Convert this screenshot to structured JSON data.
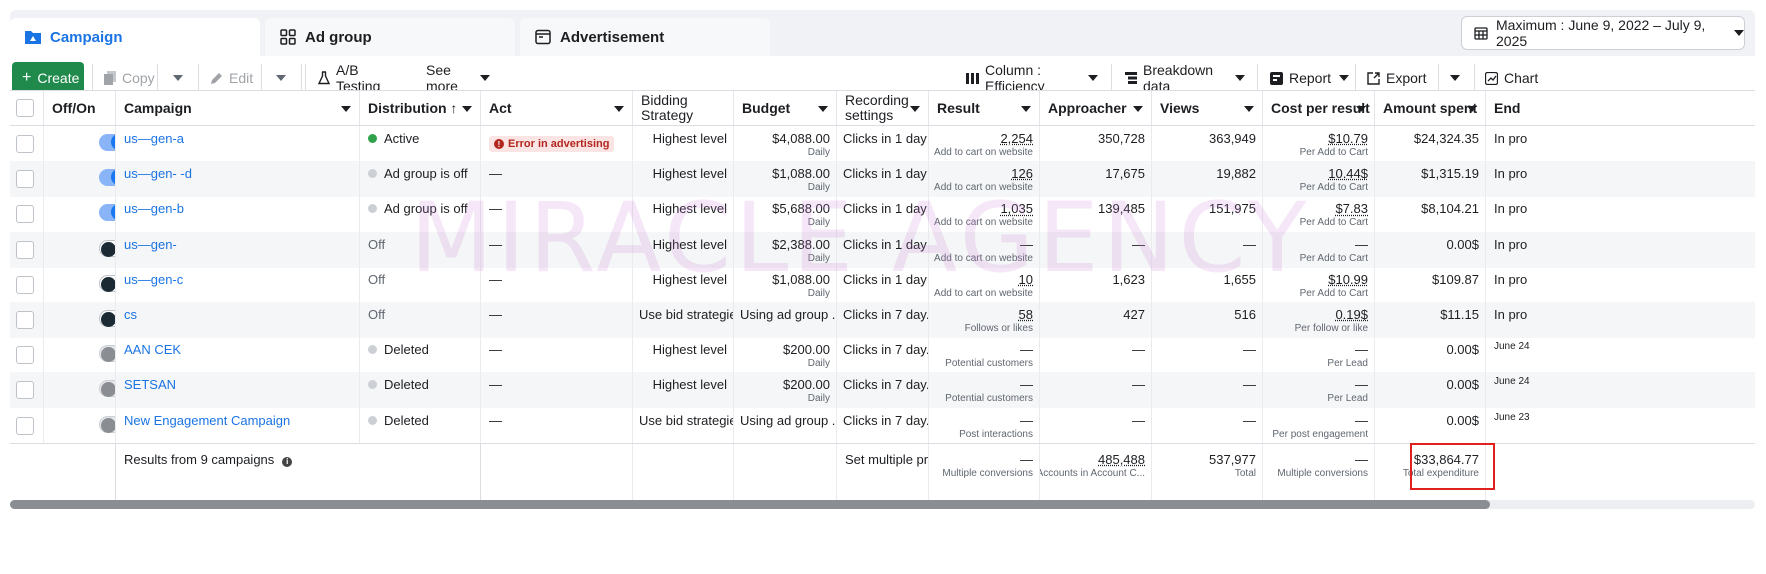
{
  "tabs": [
    {
      "label": "Campaign",
      "icon": "folder-icon",
      "active": true
    },
    {
      "label": "Ad group",
      "icon": "grid-icon",
      "active": false
    },
    {
      "label": "Advertisement",
      "icon": "ad-window-icon",
      "active": false
    }
  ],
  "date_range": "Maximum : June 9, 2022 – July 9, 2025",
  "toolbar": {
    "create": "Create",
    "copy": "Copy",
    "edit": "Edit",
    "ab_testing": "A/B Testing",
    "see_more": "See more",
    "columns": "Column : Efficiency",
    "breakdown": "Breakdown data",
    "report": "Report",
    "export": "Export",
    "chart": "Chart"
  },
  "headers": {
    "offon": "Off/On",
    "campaign": "Campaign",
    "distribution": "Distribution ↑",
    "act": "Act",
    "bidding": "Bidding Strategy",
    "budget": "Budget",
    "recording": "Recording settings",
    "result": "Result",
    "approacher": "Approacher",
    "views": "Views",
    "cpr": "Cost per result",
    "spent": "Amount spent",
    "end": "End"
  },
  "rows": [
    {
      "toggle": "on",
      "campaign": "us—gen-a",
      "dist_dot": "#31a24c",
      "distribution": "Active",
      "act": "Error in advertising",
      "act_error": true,
      "bidding": "Highest level",
      "budget": "$4,088.00",
      "budget_sub": "Daily",
      "recording": "Clicks in 1 day ...",
      "result": "2,254",
      "result_sub": "Add to cart on website",
      "approacher": "350,728",
      "views": "363,949",
      "cpr": "$10.79",
      "cpr_sub": "Per Add to Cart",
      "spent": "$24,324.35",
      "end": "In pro"
    },
    {
      "toggle": "on",
      "campaign": "us—gen- -d",
      "dist_dot": "#ccd0d5",
      "distribution": "Ad group is off",
      "act": "—",
      "act_error": false,
      "bidding": "Highest level",
      "budget": "$1,088.00",
      "budget_sub": "Daily",
      "recording": "Clicks in 1 day ...",
      "result": "126",
      "result_sub": "Add to cart on website",
      "approacher": "17,675",
      "views": "19,882",
      "cpr": "10.44$",
      "cpr_sub": "Per Add to Cart",
      "spent": "$1,315.19",
      "end": "In pro"
    },
    {
      "toggle": "on",
      "campaign": "us—gen-b",
      "dist_dot": "#ccd0d5",
      "distribution": "Ad group is off",
      "act": "—",
      "act_error": false,
      "bidding": "Highest level",
      "budget": "$5,688.00",
      "budget_sub": "Daily",
      "recording": "Clicks in 1 day ...",
      "result": "1,035",
      "result_sub": "Add to cart on website",
      "approacher": "139,485",
      "views": "151,975",
      "cpr": "$7.83",
      "cpr_sub": "Per Add to Cart",
      "spent": "$8,104.21",
      "end": "In pro"
    },
    {
      "toggle": "off",
      "campaign": "us—gen-",
      "dist_dot": "",
      "distribution": "Off",
      "act": "—",
      "act_error": false,
      "bidding": "Highest level",
      "budget": "$2,388.00",
      "budget_sub": "Daily",
      "recording": "Clicks in 1 day ...",
      "result": "—",
      "result_sub": "Add to cart on website",
      "approacher": "—",
      "views": "—",
      "cpr": "—",
      "cpr_sub": "Per Add to Cart",
      "spent": "0.00$",
      "end": "In pro"
    },
    {
      "toggle": "off",
      "campaign": "us—gen-c",
      "dist_dot": "",
      "distribution": "Off",
      "act": "—",
      "act_error": false,
      "bidding": "Highest level",
      "budget": "$1,088.00",
      "budget_sub": "Daily",
      "recording": "Clicks in 1 day ...",
      "result": "10",
      "result_sub": "Add to cart on website",
      "approacher": "1,623",
      "views": "1,655",
      "cpr": "$10.99",
      "cpr_sub": "Per Add to Cart",
      "spent": "$109.87",
      "end": "In pro"
    },
    {
      "toggle": "off",
      "campaign": "cs",
      "dist_dot": "",
      "distribution": "Off",
      "act": "—",
      "act_error": false,
      "bidding": "Use bid strategie...",
      "budget": "Using ad group ...",
      "budget_sub": "",
      "recording": "Clicks in 7 day...",
      "result": "58",
      "result_sub": "Follows or likes",
      "approacher": "427",
      "views": "516",
      "cpr": "0.19$",
      "cpr_sub": "Per follow or like",
      "spent": "$11.15",
      "end": "In pro"
    },
    {
      "toggle": "grey",
      "campaign": "AAN CEK",
      "dist_dot": "#ccd0d5",
      "distribution": "Deleted",
      "act": "—",
      "act_error": false,
      "bidding": "Highest level",
      "budget": "$200.00",
      "budget_sub": "Daily",
      "recording": "Clicks in 7 day...",
      "result": "—",
      "result_sub": "Potential customers",
      "approacher": "—",
      "views": "—",
      "cpr": "—",
      "cpr_sub": "Per Lead",
      "spent": "0.00$",
      "end": "June 24"
    },
    {
      "toggle": "grey",
      "campaign": "SETSAN",
      "dist_dot": "#ccd0d5",
      "distribution": "Deleted",
      "act": "—",
      "act_error": false,
      "bidding": "Highest level",
      "budget": "$200.00",
      "budget_sub": "Daily",
      "recording": "Clicks in 7 day...",
      "result": "—",
      "result_sub": "Potential customers",
      "approacher": "—",
      "views": "—",
      "cpr": "—",
      "cpr_sub": "Per Lead",
      "spent": "0.00$",
      "end": "June 24"
    },
    {
      "toggle": "grey",
      "campaign": "New Engagement Campaign",
      "dist_dot": "#ccd0d5",
      "distribution": "Deleted",
      "act": "—",
      "act_error": false,
      "bidding": "Use bid strategie...",
      "budget": "Using ad group ...",
      "budget_sub": "",
      "recording": "Clicks in 7 day...",
      "result": "—",
      "result_sub": "Post interactions",
      "approacher": "—",
      "views": "—",
      "cpr": "—",
      "cpr_sub": "Per post engagement",
      "spent": "0.00$",
      "end": "June 23"
    }
  ],
  "totals": {
    "label": "Results from 9 campaigns",
    "recording": "Set multiple pr...",
    "result": "—",
    "result_sub": "Multiple conversions",
    "approacher": "485,488",
    "approacher_sub": "Accounts in Account C...",
    "views": "537,977",
    "views_sub": "Total",
    "cpr": "—",
    "cpr_sub": "Multiple conversions",
    "spent": "$33,864.77",
    "spent_sub": "Total expenditure"
  },
  "watermark": "MIRACLE AGENCY",
  "colors": {
    "accent": "#1b74e4",
    "create": "#1f8a4c",
    "highlight": "#e0201c",
    "active_dot": "#31a24c"
  }
}
